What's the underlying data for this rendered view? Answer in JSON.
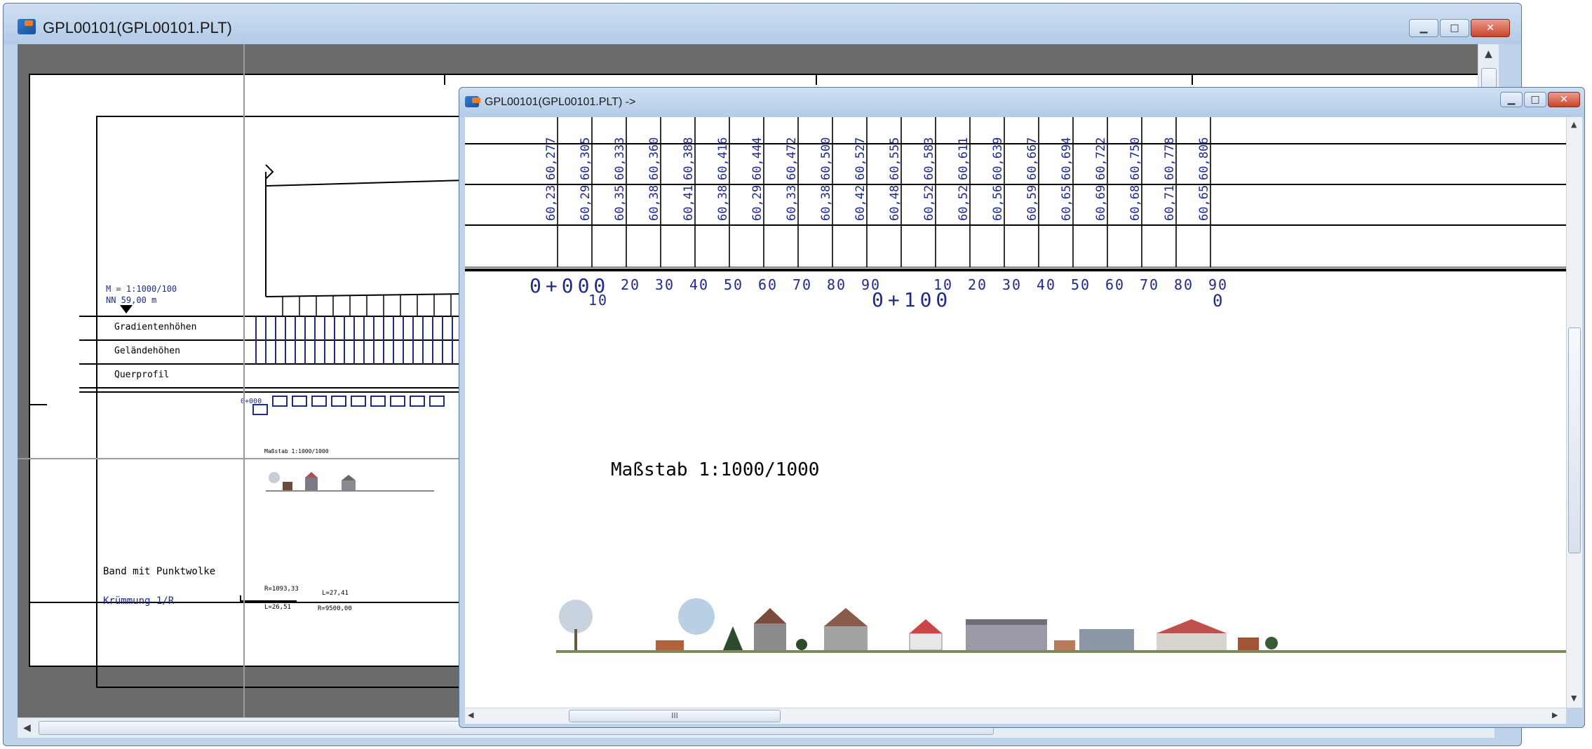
{
  "main_window": {
    "title": "GPL00101(GPL00101.PLT)",
    "buttons": {
      "minimize": "▁",
      "maximize": "□",
      "close": "✕"
    },
    "left_panel": {
      "scale_line1": "M = 1:1000/100",
      "scale_line2": "NN  59,00 m",
      "rows": [
        "Gradientenhöhen",
        "Geländehöhen",
        "Querprofil"
      ],
      "start_station": "0+000",
      "scale_note": "Maßstab 1:1000/1000",
      "band_label": "Band mit Punktwolke",
      "curvature_label": "Krümmung 1/R",
      "curve_values": [
        "R=1093,33",
        "L=27,41",
        "L=26,51",
        "R=9500,00"
      ]
    }
  },
  "sub_window": {
    "title": "GPL00101(GPL00101.PLT) ->",
    "buttons": {
      "minimize": "▁",
      "maximize": "□",
      "close": "✕"
    },
    "gradient_heights": [
      "60,277",
      "60,305",
      "60,333",
      "60,360",
      "60,388",
      "60,416",
      "60,444",
      "60,472",
      "60,500",
      "60,527",
      "60,555",
      "60,583",
      "60,611",
      "60,639",
      "60,667",
      "60,694",
      "60,722",
      "60,750",
      "60,778",
      "60,806"
    ],
    "ground_heights": [
      "60,23",
      "60,29",
      "60,35",
      "60,38",
      "60,41",
      "60,38",
      "60,29",
      "60,33",
      "60,38",
      "60,42",
      "60,48",
      "60,52",
      "60,52",
      "60,56",
      "60,59",
      "60,65",
      "60,69",
      "60,68",
      "60,71",
      "60,65"
    ],
    "stations": [
      "0+000",
      "10",
      "20",
      "30",
      "40",
      "50",
      "60",
      "70",
      "80",
      "90",
      "0+100",
      "10",
      "20",
      "30",
      "40",
      "50",
      "60",
      "70",
      "80",
      "90",
      "0"
    ],
    "scale_note": "Maßstab 1:1000/1000",
    "scroll_grip": "III"
  },
  "colors": {
    "accent": "#1f2a8f",
    "window_frame": "#bed3ea",
    "workspace": "#6b6b6b"
  }
}
